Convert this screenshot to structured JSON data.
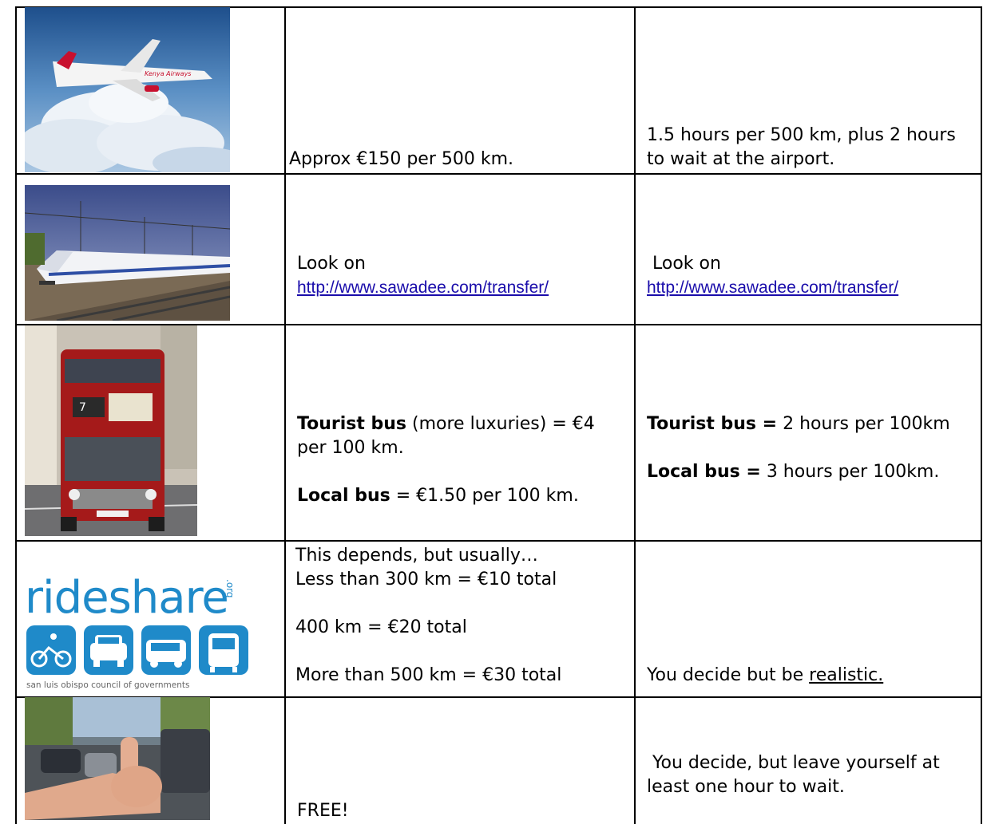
{
  "rows": [
    {
      "image": "airplane-photo",
      "cost": " Approx €150 per 500 km.",
      "time": "1.5 hours per 500 km, plus 2 hours to wait at the airport."
    },
    {
      "image": "train-photo",
      "cost_prefix": "Look on",
      "cost_link": "http://www.sawadee.com/transfer/",
      "time_prefix": " Look on",
      "time_link": "http://www.sawadee.com/transfer/"
    },
    {
      "image": "bus-photo",
      "cost_tourist_bold": "Tourist bus",
      "cost_tourist_rest": " (more luxuries) = €4 per 100 km.",
      "cost_local_bold": "Local bus",
      "cost_local_rest": " = €1.50 per 100 km.",
      "time_tourist_bold": "Tourist bus =",
      "time_tourist_rest": " 2 hours per 100km",
      "time_local_bold": "Local bus =",
      "time_local_rest": " 3 hours per 100km."
    },
    {
      "image": "rideshare-logo",
      "logo_text": "rideshare",
      "logo_suffix": ".org",
      "logo_caption": "san luis obispo council of governments",
      "cost_line1": "This depends, but usually…",
      "cost_line2": "Less than 300 km = €10 total",
      "cost_line3": "400 km = €20 total",
      "cost_line4": "More than 500 km = €30 total",
      "time_prefix": "You decide but be ",
      "time_underlined": "realistic."
    },
    {
      "image": "hitchhiking-photo",
      "cost": "FREE!",
      "time": " You decide, but leave yourself at least one hour to wait."
    }
  ],
  "colors": {
    "border": "#000000",
    "link": "#1a0dab",
    "rideshare_blue": "#1f8ac9"
  }
}
